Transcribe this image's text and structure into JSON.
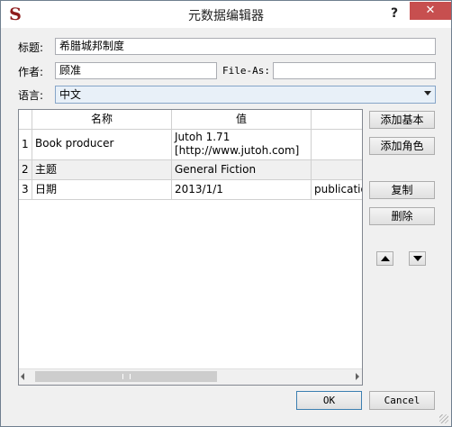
{
  "window": {
    "title": "元数据编辑器",
    "help": "?",
    "close": "✕",
    "app_icon_glyph": "S"
  },
  "form": {
    "title_label": "标题:",
    "title_value": "希腊城邦制度",
    "author_label": "作者:",
    "author_value": "顾准",
    "file_as_label": "File-As:",
    "file_as_value": "",
    "language_label": "语言:",
    "language_value": "中文"
  },
  "table": {
    "headers": [
      "名称",
      "值",
      ""
    ],
    "rows": [
      {
        "num": "1",
        "name": "Book producer",
        "value": "Jutoh 1.71 [http://www.jutoh.com]",
        "extra": ""
      },
      {
        "num": "2",
        "name": "主题",
        "value": "General Fiction",
        "extra": ""
      },
      {
        "num": "3",
        "name": "日期",
        "value": "2013/1/1",
        "extra": "publicatio"
      }
    ]
  },
  "side_buttons": {
    "add_basic": "添加基本",
    "add_role": "添加角色",
    "copy": "复制",
    "delete": "删除"
  },
  "bottom_buttons": {
    "ok": "OK",
    "cancel": "Cancel"
  },
  "colors": {
    "close_bg": "#c74f4f",
    "icon_color": "#8e1b1b",
    "select_bg": "#e8f0f8"
  }
}
